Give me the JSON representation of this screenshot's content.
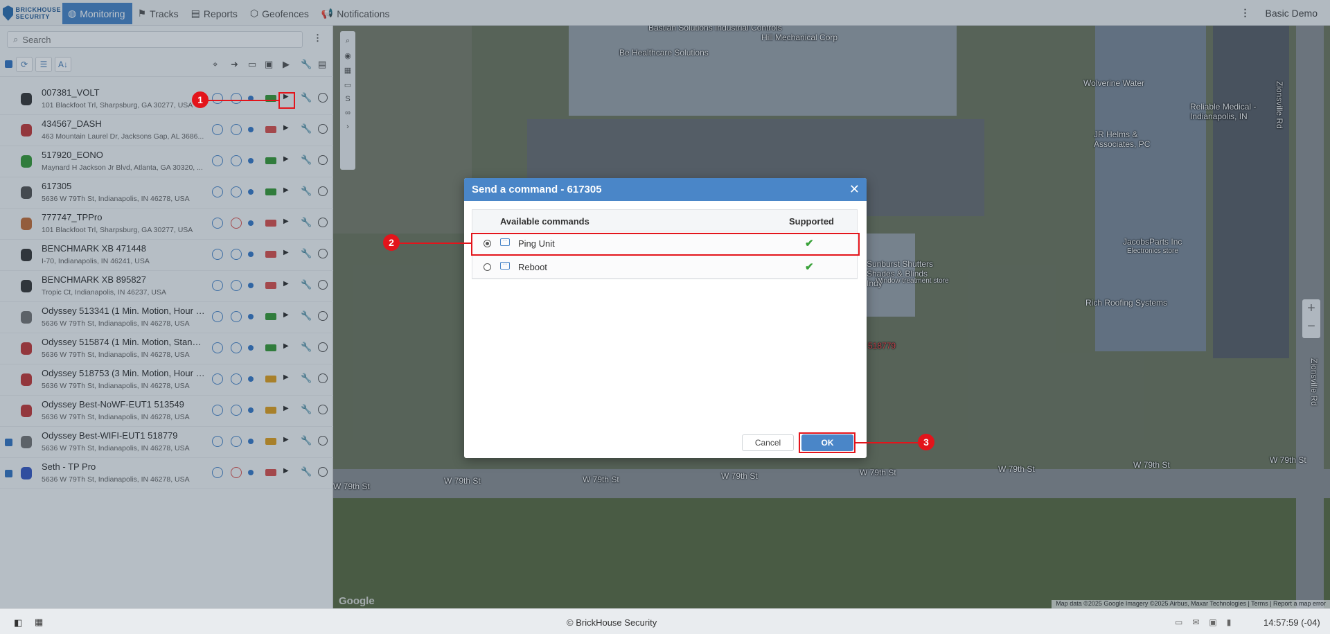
{
  "brand": {
    "logo_text_1": "BRICKHOUSE",
    "logo_text_2": "SECURITY"
  },
  "nav": [
    {
      "label": "Monitoring",
      "icon": "globe-icon",
      "active": true
    },
    {
      "label": "Tracks",
      "icon": "flag-icon"
    },
    {
      "label": "Reports",
      "icon": "document-icon"
    },
    {
      "label": "Geofences",
      "icon": "geofence-icon"
    },
    {
      "label": "Notifications",
      "icon": "megaphone-icon"
    }
  ],
  "user": {
    "name": "Basic Demo"
  },
  "sidebar": {
    "search_placeholder": "Search",
    "units": [
      {
        "name": "007381_VOLT",
        "address": "101 Blackfoot Trl, Sharpsburg, GA 30277, USA",
        "icon_color": "#3a3a3a",
        "battery_color": "#3a9a3a",
        "no_sign": "blue",
        "checked": false
      },
      {
        "name": "434567_DASH",
        "address": "463 Mountain Laurel Dr, Jacksons Gap, AL 3686...",
        "icon_color": "#c23b3b",
        "battery_color": "#d9534f",
        "no_sign": "blue",
        "checked": false
      },
      {
        "name": "517920_EONO",
        "address": "Maynard H Jackson Jr Blvd, Atlanta, GA 30320, ...",
        "icon_color": "#3a9a3a",
        "battery_color": "#3a9a3a",
        "no_sign": "blue",
        "checked": false
      },
      {
        "name": "617305",
        "address": "5636 W 79Th St, Indianapolis, IN 46278, USA",
        "icon_color": "#555555",
        "battery_color": "#3a9a3a",
        "no_sign": "blue",
        "checked": false
      },
      {
        "name": "777747_TPPro",
        "address": "101 Blackfoot Trl, Sharpsburg, GA 30277, USA",
        "icon_color": "#c2703b",
        "battery_color": "#d9534f",
        "no_sign": "red",
        "checked": false
      },
      {
        "name": "BENCHMARK XB 471448",
        "address": "I-70, Indianapolis, IN 46241, USA",
        "icon_color": "#3a3a3a",
        "battery_color": "#d9534f",
        "no_sign": "blue",
        "checked": false
      },
      {
        "name": "BENCHMARK XB 895827",
        "address": "Tropic Ct, Indianapolis, IN 46237, USA",
        "icon_color": "#3a3a3a",
        "battery_color": "#d9534f",
        "no_sign": "blue",
        "checked": false
      },
      {
        "name": "Odyssey 513341 (1 Min. Motion, Hour Dri...",
        "address": "5636 W 79Th St, Indianapolis, IN 46278, USA",
        "icon_color": "#777777",
        "battery_color": "#3a9a3a",
        "no_sign": "blue",
        "checked": false
      },
      {
        "name": "Odyssey 515874 (1 Min. Motion, Standby)",
        "address": "5636 W 79Th St, Indianapolis, IN 46278, USA",
        "icon_color": "#c23b3b",
        "battery_color": "#3a9a3a",
        "no_sign": "blue",
        "checked": false
      },
      {
        "name": "Odyssey 518753 (3 Min. Motion, Hour Dri...",
        "address": "5636 W 79Th St, Indianapolis, IN 46278, USA",
        "icon_color": "#c23b3b",
        "battery_color": "#e0a020",
        "no_sign": "blue",
        "checked": false
      },
      {
        "name": "Odyssey Best-NoWF-EUT1 513549",
        "address": "5636 W 79Th St, Indianapolis, IN 46278, USA",
        "icon_color": "#c23b3b",
        "battery_color": "#e0a020",
        "no_sign": "blue",
        "checked": false
      },
      {
        "name": "Odyssey Best-WIFI-EUT1 518779",
        "address": "5636 W 79Th St, Indianapolis, IN 46278, USA",
        "icon_color": "#777777",
        "battery_color": "#e0a020",
        "no_sign": "blue",
        "checked": true
      },
      {
        "name": "Seth - TP Pro",
        "address": "5636 W 79Th St, Indianapolis, IN 46278, USA",
        "icon_color": "#3a5ac2",
        "battery_color": "#d9534f",
        "no_sign": "red",
        "checked": true
      }
    ]
  },
  "map": {
    "labels": [
      "Bastian Solutions Industrial Controls",
      "Hill Mechanical Corp",
      "Be Healthcare Solutions",
      "Wolverine Water",
      "Reliable Medical - Indianapolis, IN",
      "JR Helms & Associates, PC",
      "JacobsParts Inc",
      "Electronics store",
      "Rich Roofing Systems",
      "Sunburst Shutters Shades & Blinds Indy",
      "Window treatment store",
      "518779",
      "W 79th St",
      "Zionsville Rd"
    ],
    "footer": "Map data ©2025 Google Imagery ©2025 Airbus, Maxar Technologies | Terms | Report a map error",
    "google": "Google"
  },
  "dialog": {
    "title": "Send a command - 617305",
    "col_commands": "Available commands",
    "col_supported": "Supported",
    "commands": [
      {
        "name": "Ping Unit",
        "selected": true,
        "supported": "✔"
      },
      {
        "name": "Reboot",
        "selected": false,
        "supported": "✔"
      }
    ],
    "cancel_label": "Cancel",
    "ok_label": "OK"
  },
  "annotations": [
    "1",
    "2",
    "3"
  ],
  "footer": {
    "copyright": "© BrickHouse Security",
    "time": "14:57:59 (-04)"
  }
}
